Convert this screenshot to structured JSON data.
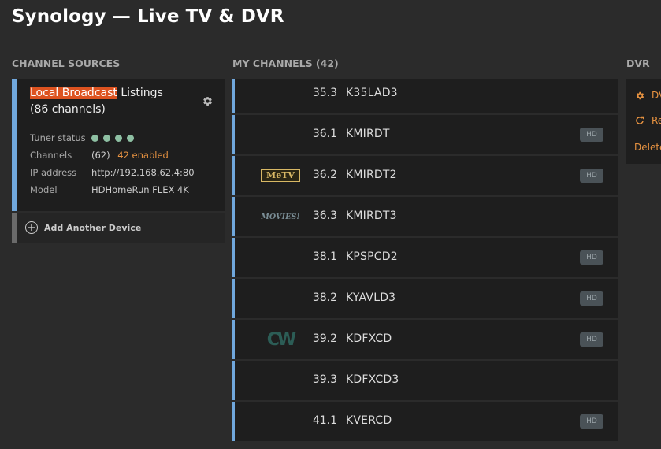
{
  "app": {
    "title": "Synology — Live TV & DVR"
  },
  "headings": {
    "channel_sources": "CHANNEL SOURCES",
    "my_channels": "MY CHANNELS (42)",
    "dvr": "DVR"
  },
  "source": {
    "title_highlight": "Local Broadcast",
    "title_rest": " Listings (86 channels)",
    "tuner_status_label": "Tuner status",
    "tuner_count": 4,
    "channels_label": "Channels",
    "channels_count": "(62)",
    "channels_enabled": "42 enabled",
    "ip_label": "IP address",
    "ip_value": "http://192.168.62.4:80",
    "model_label": "Model",
    "model_value": "HDHomeRun FLEX 4K"
  },
  "add_device": {
    "label": "Add Another Device"
  },
  "channels": [
    {
      "number": "35.3",
      "name": "K35LAD3",
      "hd": false,
      "logo": ""
    },
    {
      "number": "36.1",
      "name": "KMIRDT",
      "hd": true,
      "logo": ""
    },
    {
      "number": "36.2",
      "name": "KMIRDT2",
      "hd": true,
      "logo": "MeTV"
    },
    {
      "number": "36.3",
      "name": "KMIRDT3",
      "hd": false,
      "logo": "MOVIES!"
    },
    {
      "number": "38.1",
      "name": "KPSPCD2",
      "hd": true,
      "logo": ""
    },
    {
      "number": "38.2",
      "name": "KYAVLD3",
      "hd": true,
      "logo": ""
    },
    {
      "number": "39.2",
      "name": "KDFXCD",
      "hd": true,
      "logo": "CW"
    },
    {
      "number": "39.3",
      "name": "KDFXCD3",
      "hd": false,
      "logo": ""
    },
    {
      "number": "41.1",
      "name": "KVERCD",
      "hd": true,
      "logo": ""
    }
  ],
  "hd_label": "HD",
  "dvr": {
    "items": [
      {
        "label": "DV",
        "icon": "gear-icon"
      },
      {
        "label": "Re",
        "icon": "refresh-icon"
      },
      {
        "label": "Delete",
        "icon": ""
      }
    ]
  },
  "colors": {
    "accent_blue": "#70a7dc",
    "highlight_orange": "#dd5320",
    "link_orange": "#e89341",
    "status_green": "#8ec0a3"
  }
}
